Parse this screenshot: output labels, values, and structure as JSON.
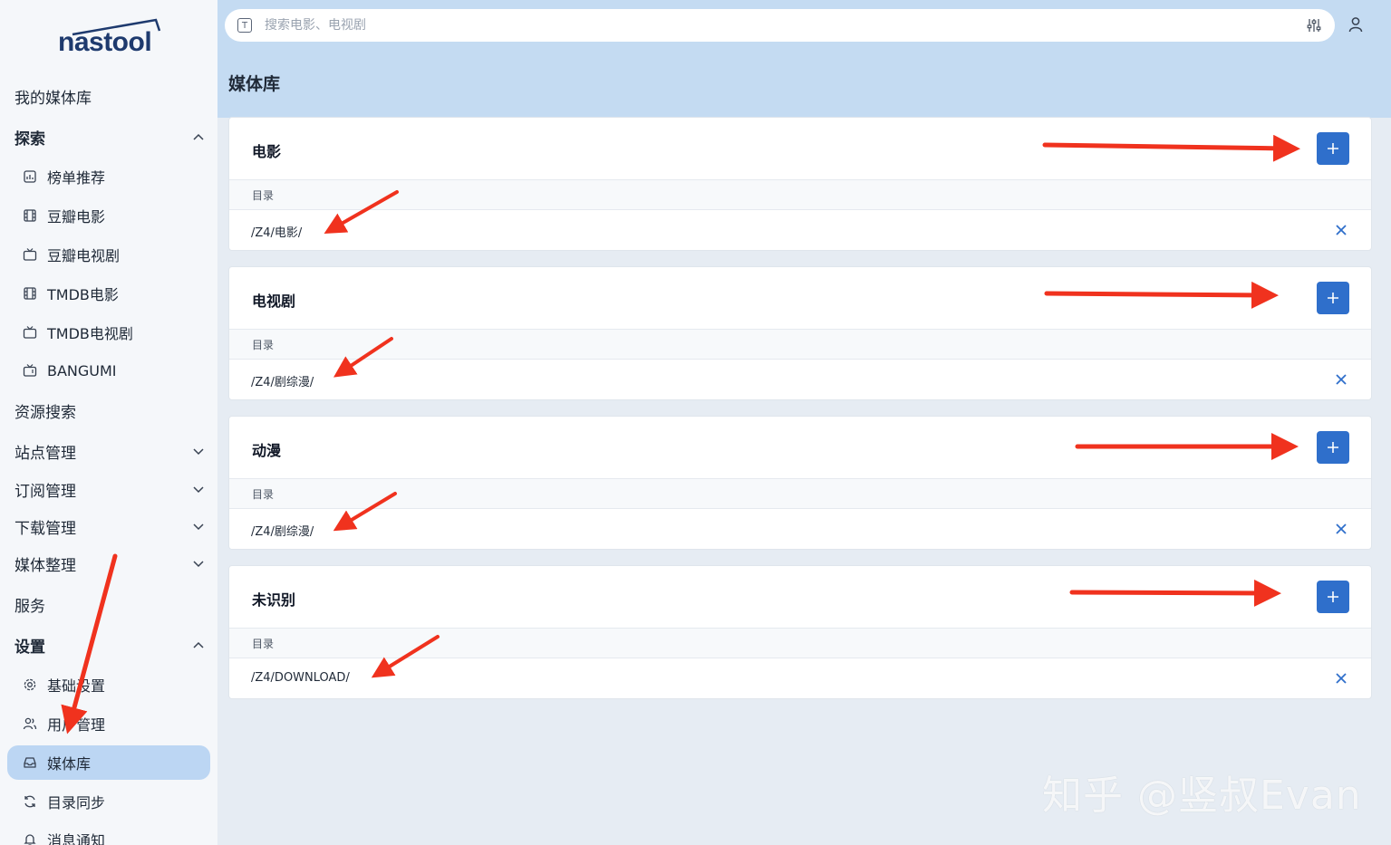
{
  "app": {
    "logo_text": "nastool"
  },
  "search": {
    "placeholder": "搜索电影、电视剧",
    "prefix": "T"
  },
  "sidebar": {
    "my_library": "我的媒体库",
    "explore": "探索",
    "explore_items": [
      "榜单推荐",
      "豆瓣电影",
      "豆瓣电视剧",
      "TMDB电影",
      "TMDB电视剧",
      "BANGUMI"
    ],
    "resource_search": "资源搜索",
    "site_mgmt": "站点管理",
    "subscribe_mgmt": "订阅管理",
    "download_mgmt": "下载管理",
    "media_org": "媒体整理",
    "service": "服务",
    "settings": "设置",
    "settings_items": [
      "基础设置",
      "用户管理",
      "媒体库",
      "目录同步",
      "消息通知"
    ],
    "active_item": "媒体库"
  },
  "main": {
    "title": "媒体库",
    "column_label": "目录",
    "sections": [
      {
        "title": "电影",
        "path": "/Z4/电影/"
      },
      {
        "title": "电视剧",
        "path": "/Z4/剧综漫/"
      },
      {
        "title": "动漫",
        "path": "/Z4/剧综漫/"
      },
      {
        "title": "未识别",
        "path": "/Z4/DOWNLOAD/"
      }
    ]
  },
  "watermark": "知乎 @竖叔Evan",
  "colors": {
    "accent": "#2f6fcb",
    "arrow": "#f0321e",
    "header_bg": "#c4dbf2",
    "active_bg": "#bcd6f3"
  }
}
